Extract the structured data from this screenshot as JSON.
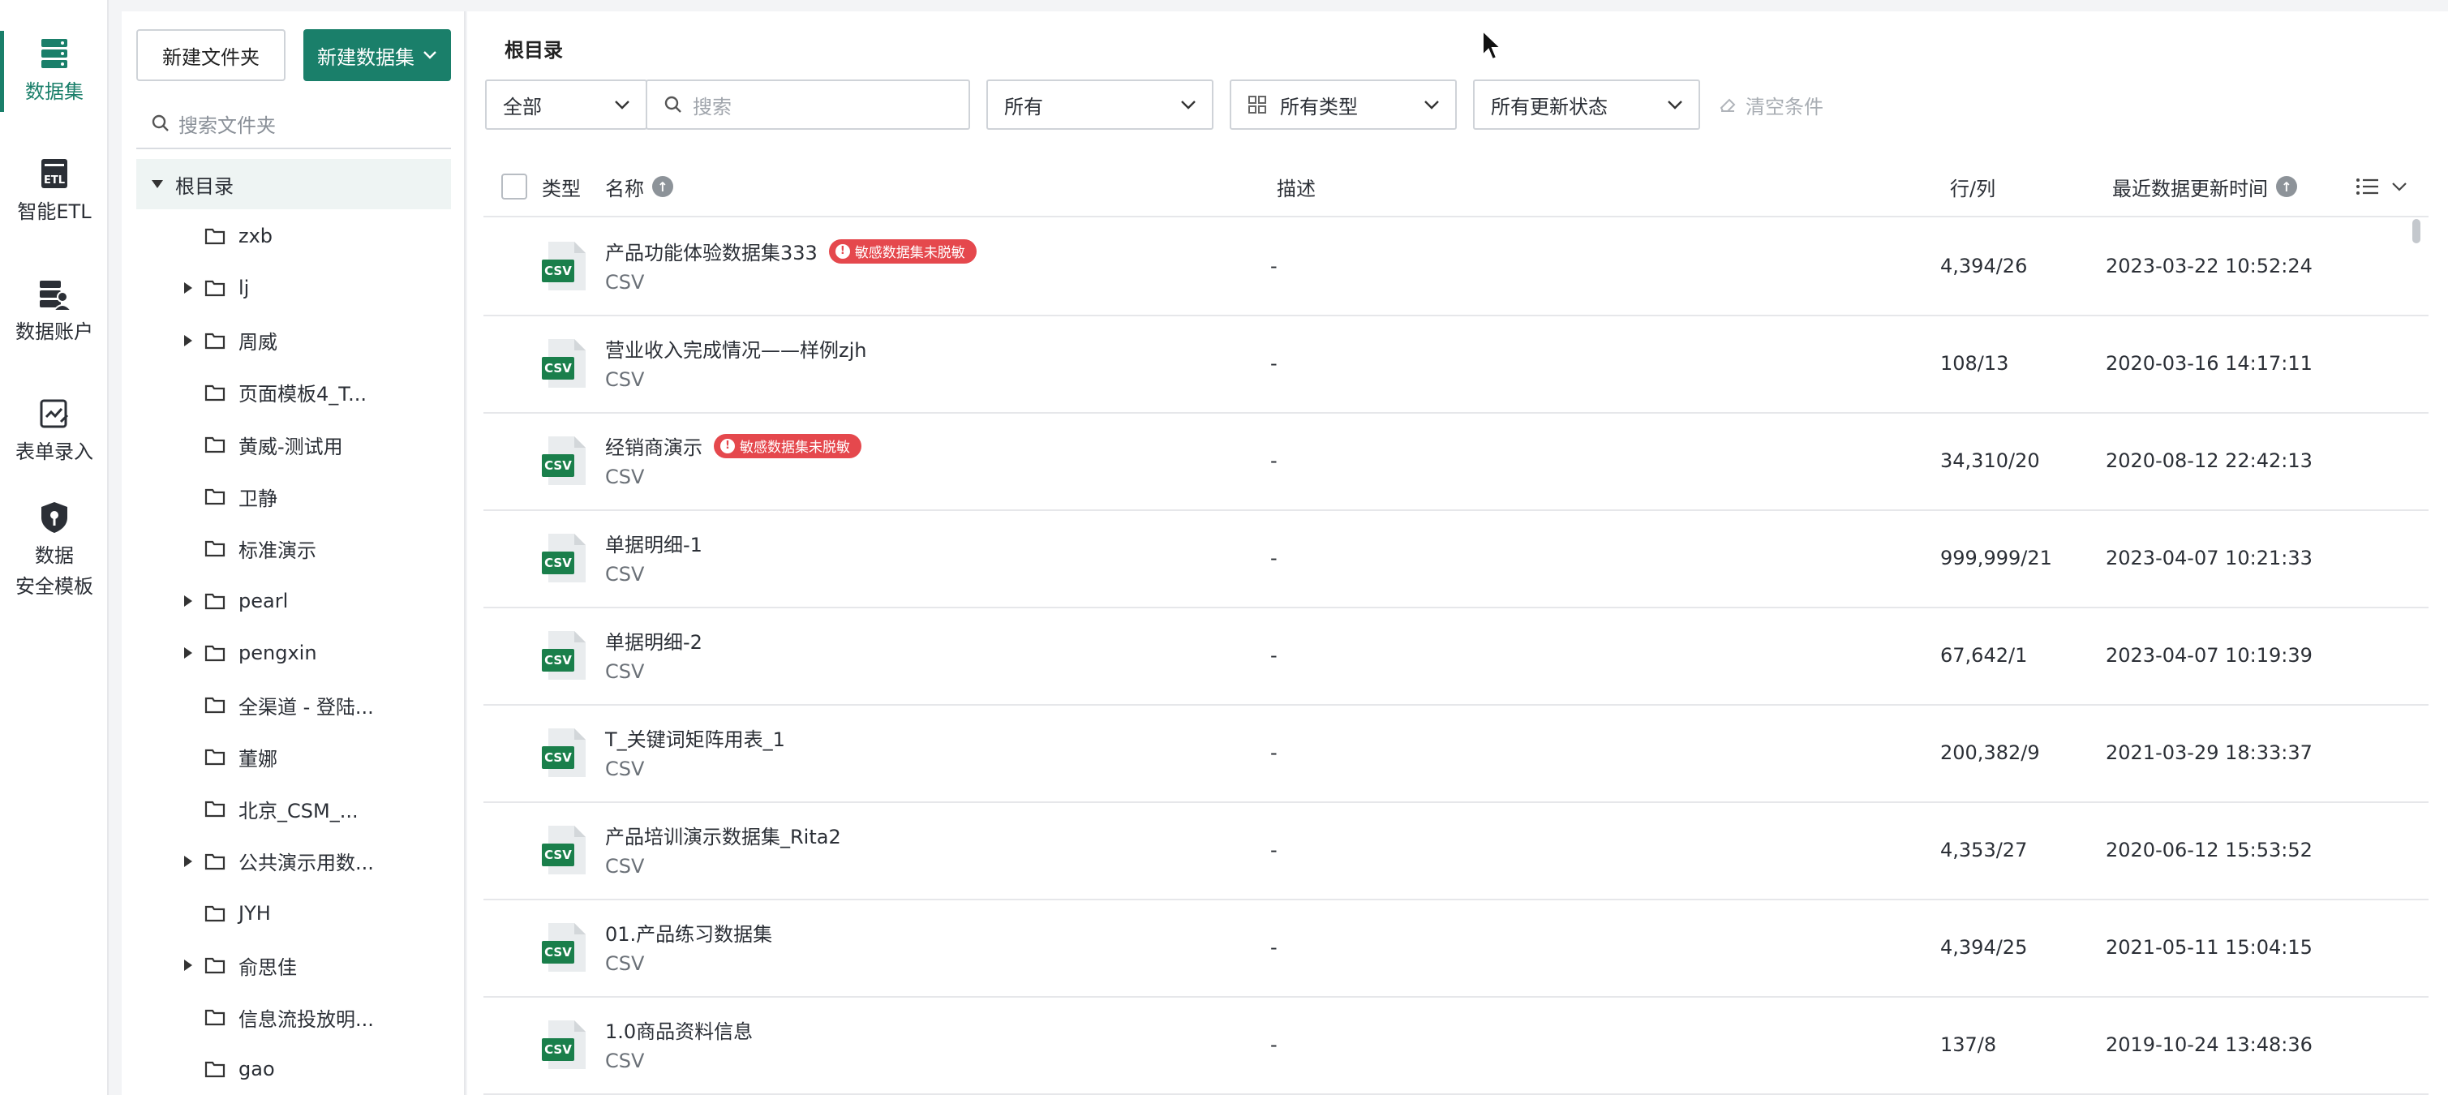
{
  "nav": {
    "items": [
      {
        "label": "数据集",
        "icon": "database-icon",
        "active": true
      },
      {
        "label": "智能ETL",
        "icon": "etl-icon",
        "active": false
      },
      {
        "label": "数据账户",
        "icon": "data-account-icon",
        "active": false
      },
      {
        "label": "表单录入",
        "icon": "form-entry-icon",
        "active": false
      },
      {
        "label_line1": "数据",
        "label_line2": "安全模板",
        "icon": "security-shield-icon",
        "active": false
      }
    ]
  },
  "folder_panel": {
    "new_folder_label": "新建文件夹",
    "new_dataset_label": "新建数据集",
    "search_placeholder": "搜索文件夹",
    "root_label": "根目录",
    "folders": [
      {
        "name": "zxb",
        "expandable": false
      },
      {
        "name": "lj",
        "expandable": true
      },
      {
        "name": "周威",
        "expandable": true
      },
      {
        "name": "页面模板4_T...",
        "expandable": false
      },
      {
        "name": "黄威-测试用",
        "expandable": false
      },
      {
        "name": "卫静",
        "expandable": false
      },
      {
        "name": "标准演示",
        "expandable": false
      },
      {
        "name": "pearl",
        "expandable": true
      },
      {
        "name": "pengxin",
        "expandable": true
      },
      {
        "name": "全渠道 - 登陆...",
        "expandable": false
      },
      {
        "name": "董娜",
        "expandable": false
      },
      {
        "name": "北京_CSM_...",
        "expandable": false
      },
      {
        "name": "公共演示用数...",
        "expandable": true
      },
      {
        "name": "JYH",
        "expandable": false
      },
      {
        "name": "俞思佳",
        "expandable": true
      },
      {
        "name": "信息流投放明...",
        "expandable": false
      },
      {
        "name": "gao",
        "expandable": false
      }
    ]
  },
  "main": {
    "breadcrumb": "根目录",
    "filters": {
      "scope": "全部",
      "search_placeholder": "搜索",
      "owner": "所有",
      "type": "所有类型",
      "update_status": "所有更新状态",
      "clear_label": "清空条件"
    },
    "columns": {
      "type": "类型",
      "name": "名称",
      "description": "描述",
      "rows_cols": "行/列",
      "last_update": "最近数据更新时间"
    },
    "badge_text": "敏感数据集未脱敏",
    "rows": [
      {
        "name": "产品功能体验数据集333",
        "type": "CSV",
        "desc": "-",
        "rc": "4,394/26",
        "time": "2023-03-22 10:52:24",
        "badge": true
      },
      {
        "name": "营业收入完成情况——样例zjh",
        "type": "CSV",
        "desc": "-",
        "rc": "108/13",
        "time": "2020-03-16 14:17:11",
        "badge": false
      },
      {
        "name": "经销商演示",
        "type": "CSV",
        "desc": "-",
        "rc": "34,310/20",
        "time": "2020-08-12 22:42:13",
        "badge": true
      },
      {
        "name": "单据明细-1",
        "type": "CSV",
        "desc": "-",
        "rc": "999,999/21",
        "time": "2023-04-07 10:21:33",
        "badge": false
      },
      {
        "name": "单据明细-2",
        "type": "CSV",
        "desc": "-",
        "rc": "67,642/1",
        "time": "2023-04-07 10:19:39",
        "badge": false
      },
      {
        "name": "T_关键词矩阵用表_1",
        "type": "CSV",
        "desc": "-",
        "rc": "200,382/9",
        "time": "2021-03-29 18:33:37",
        "badge": false
      },
      {
        "name": "产品培训演示数据集_Rita2",
        "type": "CSV",
        "desc": "-",
        "rc": "4,353/27",
        "time": "2020-06-12 15:53:52",
        "badge": false
      },
      {
        "name": "01.产品练习数据集",
        "type": "CSV",
        "desc": "-",
        "rc": "4,394/25",
        "time": "2021-05-11 15:04:15",
        "badge": false
      },
      {
        "name": "1.0商品资料信息",
        "type": "CSV",
        "desc": "-",
        "rc": "137/8",
        "time": "2019-10-24 13:48:36",
        "badge": false
      }
    ]
  },
  "colors": {
    "accent": "#1a7f6a",
    "badge": "#e5484d"
  }
}
